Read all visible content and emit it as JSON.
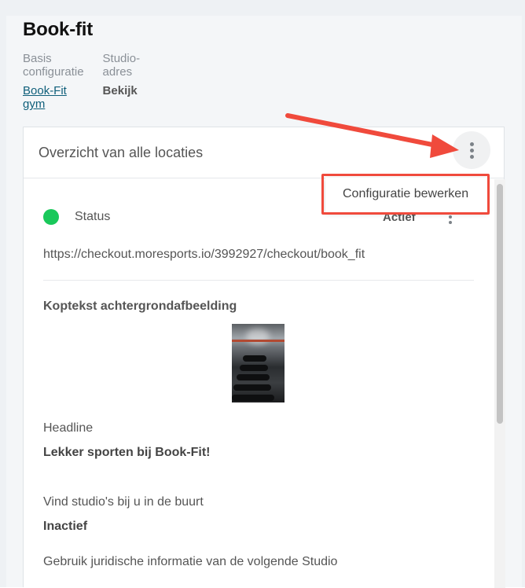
{
  "page": {
    "title": "Book-fit",
    "basis_label": "Basis configuratie",
    "basis_value": "Book-Fit gym",
    "address_label": "Studio-adres",
    "address_value": "Bekijk"
  },
  "card": {
    "title": "Overzicht van alle locaties",
    "menu_item": "Configuratie bewerken",
    "status_label": "Status",
    "status_value": "Actief",
    "url": "https://checkout.moresports.io/3992927/checkout/book_fit",
    "section_title": "Koptekst achtergrondafbeelding",
    "headline_label": "Headline",
    "headline_value": "Lekker sporten bij Book-Fit!",
    "nearby_label": "Vind studio's bij u in de buurt",
    "nearby_value": "Inactief",
    "legal_label": "Gebruik juridische informatie van de volgende Studio"
  },
  "colors": {
    "status_active": "#19c85a",
    "link": "#0f5f7a",
    "annotation": "#f04a3c"
  },
  "icons": [
    "kebab-menu-icon",
    "annotation-arrow"
  ]
}
